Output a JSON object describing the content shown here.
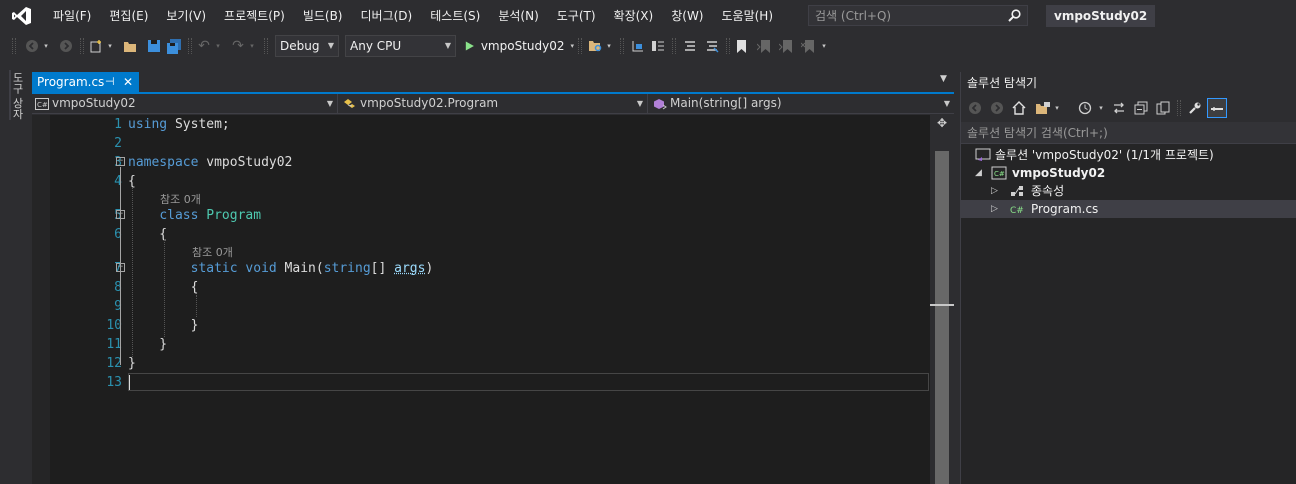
{
  "menubar": {
    "items": [
      "파일(F)",
      "편집(E)",
      "보기(V)",
      "프로젝트(P)",
      "빌드(B)",
      "디버그(D)",
      "테스트(S)",
      "분석(N)",
      "도구(T)",
      "확장(X)",
      "창(W)",
      "도움말(H)"
    ],
    "search_placeholder": "검색 (Ctrl+Q)",
    "project_title": "vmpoStudy02"
  },
  "toolbar": {
    "config": "Debug",
    "platform": "Any CPU",
    "start_label": "vmpoStudy02"
  },
  "left_strip": {
    "toolbox_label": "도구 상자"
  },
  "document": {
    "tab_title": "Program.cs",
    "nav_project": "vmpoStudy02",
    "nav_class": "vmpoStudy02.Program",
    "nav_member": "Main(string[] args)"
  },
  "code": {
    "lines": [
      {
        "n": "1",
        "parts": [
          [
            "kw",
            "using"
          ],
          [
            "",
            " System;"
          ]
        ]
      },
      {
        "n": "2",
        "parts": []
      },
      {
        "n": "3",
        "parts": [
          [
            "kw",
            "namespace"
          ],
          [
            "",
            " vmpoStudy02"
          ]
        ]
      },
      {
        "n": "4",
        "parts": [
          [
            "",
            "{"
          ]
        ]
      },
      {
        "n": "5",
        "parts": [
          [
            "",
            "    "
          ],
          [
            "kw",
            "class"
          ],
          [
            "",
            " "
          ],
          [
            "ty",
            "Program"
          ]
        ]
      },
      {
        "n": "6",
        "parts": [
          [
            "",
            "    {"
          ]
        ]
      },
      {
        "n": "7",
        "parts": [
          [
            "",
            "        "
          ],
          [
            "kw",
            "static"
          ],
          [
            "",
            " "
          ],
          [
            "kw",
            "void"
          ],
          [
            "",
            " Main("
          ],
          [
            "kw",
            "string"
          ],
          [
            "",
            "[] "
          ],
          [
            "param",
            "args"
          ],
          [
            "",
            ")"
          ]
        ]
      },
      {
        "n": "8",
        "parts": [
          [
            "",
            "        {"
          ]
        ]
      },
      {
        "n": "9",
        "parts": []
      },
      {
        "n": "10",
        "parts": [
          [
            "",
            "        }"
          ]
        ]
      },
      {
        "n": "11",
        "parts": [
          [
            "",
            "    }"
          ]
        ]
      },
      {
        "n": "12",
        "parts": [
          [
            "",
            "}"
          ]
        ]
      },
      {
        "n": "13",
        "parts": []
      }
    ],
    "ref_hint_class": "참조 0개",
    "ref_hint_method": "참조 0개"
  },
  "solution_explorer": {
    "title": "솔루션 탐색기",
    "search_placeholder": "솔루션 탐색기 검색(Ctrl+;)",
    "solution_label": "솔루션 'vmpoStudy02' (1/1개 프로젝트)",
    "project_label": "vmpoStudy02",
    "dependencies_label": "종속성",
    "file_label": "Program.cs"
  },
  "colors": {
    "accent": "#007acc",
    "keyword": "#569cd6",
    "type": "#4ec9b0",
    "line_number": "#2b91af",
    "editor_bg": "#1e1e1e",
    "chrome_bg": "#2d2d30"
  }
}
